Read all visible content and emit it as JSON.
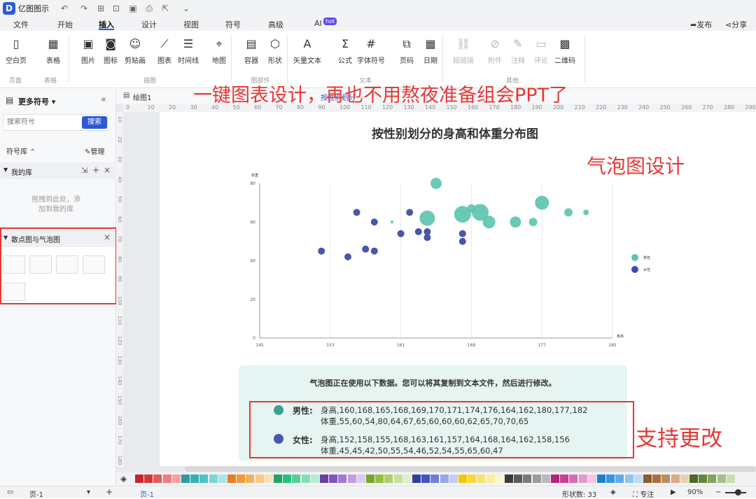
{
  "app": {
    "name": "亿图图示",
    "logo": "D"
  },
  "menu": {
    "tabs": [
      "文件",
      "开始",
      "插入",
      "设计",
      "视图",
      "符号",
      "高级",
      "AI"
    ],
    "active": "插入",
    "ai_badge": "hot",
    "publish": "发布",
    "share": "分享"
  },
  "ribbon": {
    "buttons": [
      {
        "label": "空白页",
        "icon": "blank-page-icon"
      },
      {
        "label": "表格",
        "icon": "table-icon"
      },
      {
        "label": "图片",
        "icon": "image-icon"
      },
      {
        "label": "图标",
        "icon": "icon-icon"
      },
      {
        "label": "剪贴画",
        "icon": "clipart-icon"
      },
      {
        "label": "图表",
        "icon": "chart-icon"
      },
      {
        "label": "时间线",
        "icon": "timeline-icon"
      },
      {
        "label": "地图",
        "icon": "map-icon"
      },
      {
        "label": "容器",
        "icon": "container-icon"
      },
      {
        "label": "形状",
        "icon": "shape-icon"
      },
      {
        "label": "矢量文本",
        "icon": "vector-text-icon"
      },
      {
        "label": "公式",
        "icon": "formula-icon"
      },
      {
        "label": "字体符号",
        "icon": "font-symbol-icon"
      },
      {
        "label": "页码",
        "icon": "page-number-icon"
      },
      {
        "label": "日期",
        "icon": "date-icon"
      },
      {
        "label": "超链接",
        "icon": "hyperlink-icon"
      },
      {
        "label": "附件",
        "icon": "attachment-icon"
      },
      {
        "label": "注释",
        "icon": "annotation-icon"
      },
      {
        "label": "评论",
        "icon": "comment-icon"
      },
      {
        "label": "二维码",
        "icon": "qrcode-icon"
      }
    ],
    "groups": [
      "页面",
      "表格",
      "插图",
      "图部件",
      "文本",
      "其他"
    ]
  },
  "sidebar": {
    "title": "更多符号",
    "search_placeholder": "搜索符号",
    "search_button": "搜索",
    "library_label": "符号库",
    "manage_label": "管理",
    "my_library": "我的库",
    "empty_hint_1": "拖拽到此处，添",
    "empty_hint_2": "加到我的库",
    "scatter_section": "散点图与气泡图"
  },
  "canvas": {
    "doc_tab": "绘图1",
    "doc_tab2": "按性别划分",
    "overlay_title": "一键图表设计，再也不用熬夜准备组会PPT了",
    "bubble_design_label": "气泡图设计",
    "support_label": "支持更改",
    "ruler_h": [
      "0",
      "10",
      "20",
      "30",
      "40",
      "50",
      "60",
      "70",
      "80",
      "90",
      "100",
      "110",
      "120",
      "130",
      "140",
      "150",
      "160",
      "170",
      "180",
      "190",
      "200",
      "210",
      "220",
      "230",
      "240",
      "250",
      "260",
      "270",
      "280",
      "290"
    ],
    "ruler_v": [
      "10",
      "20",
      "30",
      "40",
      "50",
      "60",
      "70",
      "80",
      "90",
      "100",
      "110",
      "120",
      "130",
      "140",
      "150",
      "160",
      "170",
      "180"
    ]
  },
  "chart_data": {
    "type": "scatter",
    "title": "按性别划分的身高和体重分布图",
    "xlabel": "身高",
    "ylabel": "体重",
    "xlim": [
      145,
      185
    ],
    "ylim": [
      0,
      80
    ],
    "xticks": [
      "145",
      "153",
      "161",
      "169",
      "177",
      "185"
    ],
    "yticks": [
      "0",
      "20",
      "40",
      "60",
      "80"
    ],
    "grid": true,
    "legend_position": "right",
    "series": [
      {
        "name": "男性",
        "color": "#5ec4b0",
        "points": [
          {
            "x": 160,
            "y": 60,
            "r": 2
          },
          {
            "x": 164,
            "y": 62,
            "r": 11
          },
          {
            "x": 168,
            "y": 64,
            "r": 12
          },
          {
            "x": 169,
            "y": 67,
            "r": 6
          },
          {
            "x": 170,
            "y": 65,
            "r": 12
          },
          {
            "x": 171,
            "y": 60,
            "r": 9
          },
          {
            "x": 174,
            "y": 60,
            "r": 8
          },
          {
            "x": 176,
            "y": 60,
            "r": 6
          },
          {
            "x": 165,
            "y": 80,
            "r": 8
          },
          {
            "x": 177,
            "y": 70,
            "r": 10
          },
          {
            "x": 180,
            "y": 65,
            "r": 6
          },
          {
            "x": 182,
            "y": 65,
            "r": 4
          }
        ]
      },
      {
        "name": "女性",
        "color": "#3f4da8",
        "points": [
          {
            "x": 152,
            "y": 45,
            "r": 5
          },
          {
            "x": 155,
            "y": 42,
            "r": 5
          },
          {
            "x": 156,
            "y": 65,
            "r": 5
          },
          {
            "x": 157,
            "y": 46,
            "r": 5
          },
          {
            "x": 158,
            "y": 60,
            "r": 5
          },
          {
            "x": 158,
            "y": 45,
            "r": 5
          },
          {
            "x": 161,
            "y": 54,
            "r": 5
          },
          {
            "x": 162,
            "y": 65,
            "r": 5
          },
          {
            "x": 163,
            "y": 55,
            "r": 5
          },
          {
            "x": 164,
            "y": 52,
            "r": 5
          },
          {
            "x": 164,
            "y": 55,
            "r": 5
          },
          {
            "x": 168,
            "y": 54,
            "r": 5
          },
          {
            "x": 168,
            "y": 50,
            "r": 5
          }
        ]
      }
    ]
  },
  "info": {
    "text": "气泡图正在使用以下数据。您可以将其复制到文本文件，然后进行修改。",
    "male": {
      "label": "男性:",
      "color": "#3aa090",
      "height_line": "身高,160,168,165,168,169,170,171,174,176,164,162,180,177,182",
      "weight_line": "体重,55,60,54,80,64,67,65,60,60,60,62,65,70,70,65"
    },
    "female": {
      "label": "女性:",
      "color": "#4a55b8",
      "height_line": "身高,152,158,155,168,163,161,157,164,168,164,162,158,156",
      "weight_line": "体重,45,45,42,50,55,54,46,52,54,55,65,60,47"
    }
  },
  "palette": [
    "#c0282e",
    "#d83434",
    "#e45a5a",
    "#f07c7c",
    "#f4a3a3",
    "#2e9aa0",
    "#34b1b5",
    "#4cc4c4",
    "#7dd6d6",
    "#a8e5e5",
    "#e57c2a",
    "#f09a3a",
    "#f4b25e",
    "#f8c884",
    "#fae0b4",
    "#1fa36a",
    "#2bbf7e",
    "#53cf98",
    "#86deb6",
    "#b7ecd2",
    "#6a3fa0",
    "#8456b8",
    "#a07ad0",
    "#bea0e0",
    "#dccaf0",
    "#7aa52b",
    "#94c03c",
    "#aed067",
    "#c8e097",
    "#e0efc6",
    "#2d3f9f",
    "#3e54c0",
    "#6b7fd4",
    "#98a6e2",
    "#c4ccee",
    "#f2c80f",
    "#f8d83c",
    "#fae26c",
    "#fcec9e",
    "#fdf5cf",
    "#3a3a3a",
    "#5a5a5a",
    "#7a7a7a",
    "#9a9a9a",
    "#bababa",
    "#b3247a",
    "#cc3d93",
    "#dc6aaf",
    "#e898c9",
    "#f3c6e2",
    "#1f7fcf",
    "#3794e0",
    "#62acea",
    "#8fc5f1",
    "#bcdcf7",
    "#8b5a2b",
    "#a87040",
    "#c08d5e",
    "#d6ad86",
    "#ead0b3",
    "#4a6b2a",
    "#63873a",
    "#84a35c",
    "#a8bf86",
    "#cddbb4"
  ],
  "status": {
    "page_label": "页-1",
    "page_tab": "页-1",
    "shape_count": "形状数: 33",
    "focus": "专注",
    "zoom": "90%"
  }
}
